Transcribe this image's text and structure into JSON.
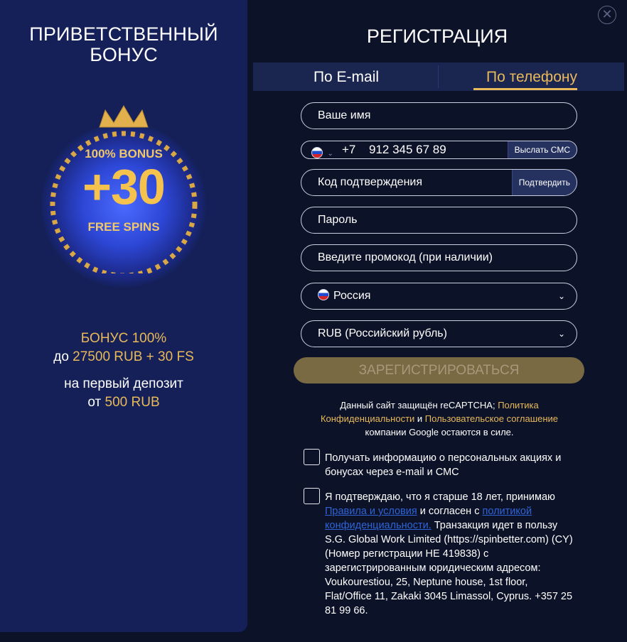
{
  "promo": {
    "title_line1": "ПРИВЕТСТВЕННЫЙ",
    "title_line2": "БОНУС",
    "badge_top": "100% BONUS",
    "badge_big": "+30",
    "badge_bottom": "FREE SPINS",
    "line1": "БОНУС 100%",
    "line2_prefix": "до ",
    "line2_amount": "27500 RUB + 30 FS",
    "line3": "на первый депозит",
    "line4_prefix": "от ",
    "line4_amount": "500 RUB"
  },
  "header": {
    "title": "РЕГИСТРАЦИЯ",
    "close_icon": "close-icon"
  },
  "tabs": [
    {
      "label": "По E-mail",
      "active": false
    },
    {
      "label": "По телефону",
      "active": true
    }
  ],
  "form": {
    "name_placeholder": "Ваше имя",
    "phone_code": "+7",
    "phone_number": "912 345 67 89",
    "send_sms_label": "Выслать СМС",
    "code_placeholder": "Код подтверждения",
    "confirm_label": "Подтвердить",
    "password_placeholder": "Пароль",
    "promo_placeholder": "Введите промокод (при наличии)",
    "country_value": "Россия",
    "currency_value": "RUB (Российский рубль)",
    "register_label": "ЗАРЕГИСТРИРОВАТЬСЯ"
  },
  "recaptcha": {
    "text1": "Данный сайт защищён reCAPTCHA; ",
    "link1": "Политика Конфиденциальности",
    "text2": " и ",
    "link2": "Пользовательское соглашение",
    "text3": " компании Google остаются в силе."
  },
  "consent": {
    "promo_opt_in": "Получать информацию о персональных акциях и бонусах через e-mail и СМС",
    "age_text1": "Я подтверждаю, что я старше 18 лет, принимаю ",
    "age_link1": "Правила и условия",
    "age_text2": " и согласен с ",
    "age_link2": "политикой конфиденциальности.",
    "age_text3": " Транзакция идет в пользу S.G. Global Work Limited (https://spinbetter.com) (CY) (Номер регистрации HE 419838) с зарегистрированным юридическим адресом: Voukourestiou, 25, Neptune house, 1st floor, Flat/Office 11, Zakaki 3045 Limassol, Cyprus. +357 25 81 99 66."
  },
  "colors": {
    "accent_gold": "#e9b95a",
    "panel_blue": "#142057",
    "background": "#0c1228",
    "link_blue": "#2f64d8"
  }
}
